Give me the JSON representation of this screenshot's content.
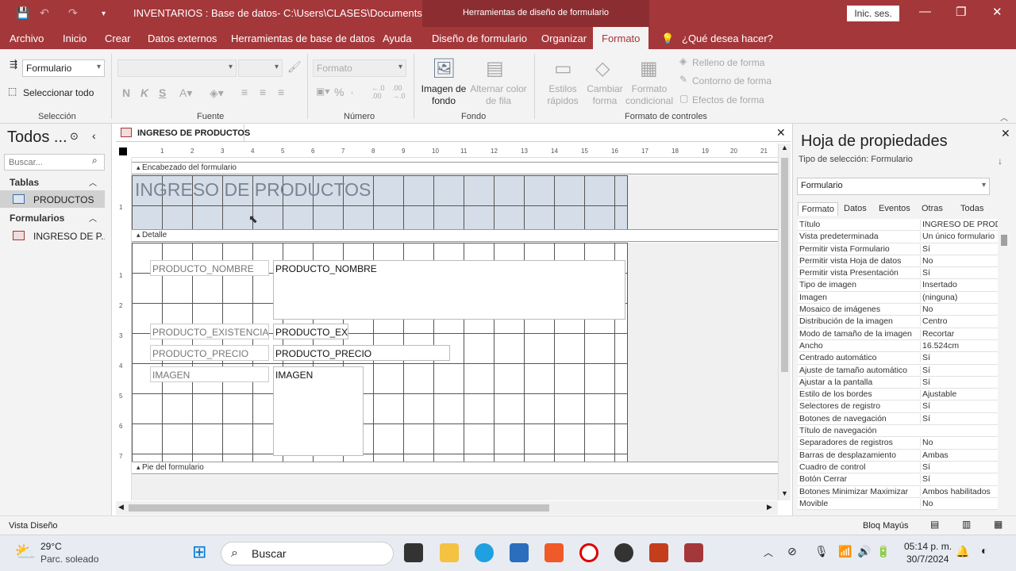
{
  "titlebar": {
    "title": "INVENTARIOS : Base de datos- C:\\Users\\CLASES\\Documents\\I...",
    "context_tools": "Herramientas de diseño de formulario",
    "signin": "Inic. ses."
  },
  "menu": [
    "Archivo",
    "Inicio",
    "Crear",
    "Datos externos",
    "Herramientas de base de datos",
    "Ayuda",
    "Diseño de formulario",
    "Organizar",
    "Formato"
  ],
  "menu_search": "¿Qué desea hacer?",
  "ribbon": {
    "selector_value": "Formulario",
    "select_all": "Seleccionar todo",
    "group_seleccion": "Selección",
    "group_fuente": "Fuente",
    "bold": "N",
    "italic": "K",
    "underline": "S",
    "group_numero": "Número",
    "number_format": "Formato",
    "bg_image": "Imagen de fondo",
    "alt_row": "Alternar color de fila",
    "group_fondo": "Fondo",
    "quick_styles": "Estilos rápidos",
    "change_shape": "Cambiar forma",
    "cond_format": "Formato condicional",
    "fill": "Relleno de forma",
    "outline": "Contorno de forma",
    "effects": "Efectos de forma",
    "group_controles": "Formato de controles"
  },
  "nav": {
    "title": "Todos ...",
    "search_placeholder": "Buscar...",
    "sec_tables": "Tablas",
    "table_item": "PRODUCTOS",
    "sec_forms": "Formularios",
    "form_item": "INGRESO DE P..."
  },
  "doc": {
    "tab": "INGRESO DE PRODUCTOS",
    "ruler_h": [
      "1",
      "2",
      "3",
      "4",
      "5",
      "6",
      "7",
      "8",
      "9",
      "10",
      "11",
      "12",
      "13",
      "14",
      "15",
      "16",
      "17",
      "18",
      "19",
      "20",
      "21"
    ],
    "ruler_v_header": [
      "1"
    ],
    "ruler_v_detail": [
      "1",
      "2",
      "3",
      "4",
      "5",
      "6",
      "7"
    ],
    "sec_header": "Encabezado del formulario",
    "form_title": "INGRESO DE PRODUCTOS",
    "sec_detail": "Detalle",
    "sec_footer": "Pie del formulario",
    "label_nombre": "PRODUCTO_NOMBRE",
    "field_nombre": "PRODUCTO_NOMBRE",
    "label_existencia": "PRODUCTO_EXISTENCIA",
    "field_existencia": "PRODUCTO_EX",
    "label_precio": "PRODUCTO_PRECIO",
    "field_precio": "PRODUCTO_PRECIO",
    "label_imagen": "IMAGEN",
    "field_imagen": "IMAGEN"
  },
  "props": {
    "title": "Hoja de propiedades",
    "selection_type": "Tipo de selección:  Formulario",
    "object": "Formulario",
    "tabs": [
      "Formato",
      "Datos",
      "Eventos",
      "Otras",
      "Todas"
    ],
    "rows": [
      [
        "Título",
        "INGRESO DE PRODU"
      ],
      [
        "Vista predeterminada",
        "Un único formulario"
      ],
      [
        "Permitir vista Formulario",
        "Sí"
      ],
      [
        "Permitir vista Hoja de datos",
        "No"
      ],
      [
        "Permitir vista Presentación",
        "Sí"
      ],
      [
        "Tipo de imagen",
        "Insertado"
      ],
      [
        "Imagen",
        "(ninguna)"
      ],
      [
        "Mosaico de imágenes",
        "No"
      ],
      [
        "Distribución de la imagen",
        "Centro"
      ],
      [
        "Modo de tamaño de la imagen",
        "Recortar"
      ],
      [
        "Ancho",
        "16.524cm"
      ],
      [
        "Centrado automático",
        "Sí"
      ],
      [
        "Ajuste de tamaño automático",
        "Sí"
      ],
      [
        "Ajustar a la pantalla",
        "Sí"
      ],
      [
        "Estilo de los bordes",
        "Ajustable"
      ],
      [
        "Selectores de registro",
        "Sí"
      ],
      [
        "Botones de navegación",
        "Sí"
      ],
      [
        "Título de navegación",
        ""
      ],
      [
        "Separadores de registros",
        "No"
      ],
      [
        "Barras de desplazamiento",
        "Ambas"
      ],
      [
        "Cuadro de control",
        "Sí"
      ],
      [
        "Botón Cerrar",
        "Sí"
      ],
      [
        "Botones Minimizar Maximizar",
        "Ambos habilitados"
      ],
      [
        "Movible",
        "No"
      ]
    ]
  },
  "status": {
    "left": "Vista Diseño",
    "right": "Bloq Mayús"
  },
  "taskbar": {
    "temp": "29°C",
    "weather": "Parc. soleado",
    "search": "Buscar",
    "time": "05:14 p. m.",
    "date": "30/7/2024"
  }
}
